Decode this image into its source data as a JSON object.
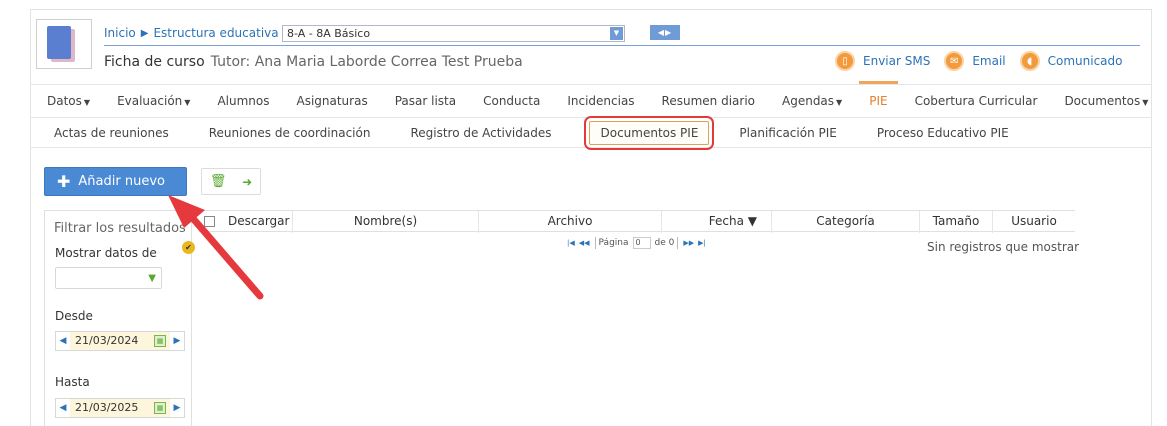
{
  "breadcrumb": {
    "home": "Inicio",
    "section": "Estructura educativa",
    "course_select": "8-A - 8A Básico"
  },
  "header": {
    "ficha_label": "Ficha de curso",
    "tutor": "Tutor: Ana Maria Laborde Correa Test Prueba",
    "actions": [
      {
        "label": "Enviar SMS",
        "icon": "phone-icon"
      },
      {
        "label": "Email",
        "icon": "mail-icon"
      },
      {
        "label": "Comunicado",
        "icon": "megaphone-icon"
      }
    ]
  },
  "tabs": [
    {
      "label": "Datos",
      "dropdown": true
    },
    {
      "label": "Evaluación",
      "dropdown": true
    },
    {
      "label": "Alumnos"
    },
    {
      "label": "Asignaturas"
    },
    {
      "label": "Pasar lista"
    },
    {
      "label": "Conducta"
    },
    {
      "label": "Incidencias"
    },
    {
      "label": "Resumen diario"
    },
    {
      "label": "Agendas",
      "dropdown": true
    },
    {
      "label": "PIE",
      "active": true
    },
    {
      "label": "Cobertura Curricular"
    },
    {
      "label": "Documentos",
      "dropdown": true
    }
  ],
  "subtabs": [
    {
      "label": "Actas de reuniones"
    },
    {
      "label": "Reuniones de coordinación"
    },
    {
      "label": "Registro de Actividades"
    },
    {
      "label": "Documentos PIE",
      "active": true
    },
    {
      "label": "Planificación PIE"
    },
    {
      "label": "Proceso Educativo PIE"
    }
  ],
  "toolbar": {
    "add_label": "Añadir nuevo"
  },
  "filter": {
    "title": "Filtrar los resultados",
    "show_data_label": "Mostrar datos de",
    "from_label": "Desde",
    "from_value": "21/03/2024",
    "to_label": "Hasta",
    "to_value": "21/03/2025"
  },
  "grid": {
    "columns": [
      "Descargar",
      "Nombre(s)",
      "Archivo",
      "Fecha ▼",
      "Categoría",
      "Tamaño",
      "Usuario"
    ],
    "pager": {
      "page_label": "Página",
      "page_value": "0",
      "of_label": "de 0"
    },
    "empty_message": "Sin registros que mostrar"
  },
  "colors": {
    "accent_blue": "#4a89d3",
    "link_blue": "#2b73b6",
    "active_orange": "#e87d2b",
    "highlight_red": "#e23a3a",
    "action_orange": "#f29a3c"
  }
}
